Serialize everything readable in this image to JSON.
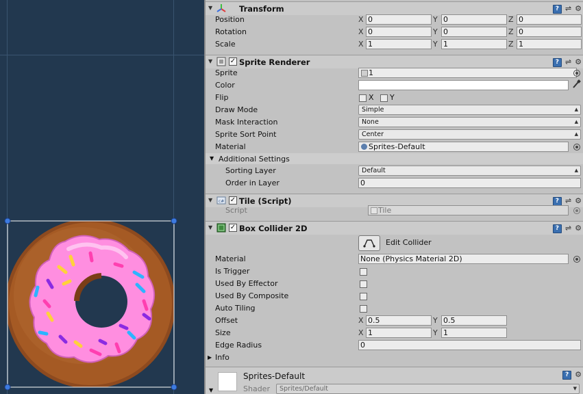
{
  "colors": {
    "scene_bg": "#22384f",
    "inspector_bg": "#c2c2c2",
    "selection_outline": "#ffffff",
    "handle": "#3d7be0",
    "icing": "#ff8ee0",
    "dough": "#9a5120"
  },
  "transform": {
    "title": "Transform",
    "position": {
      "label": "Position",
      "x": "0",
      "y": "0",
      "z": "0"
    },
    "rotation": {
      "label": "Rotation",
      "x": "0",
      "y": "0",
      "z": "0"
    },
    "scale": {
      "label": "Scale",
      "x": "1",
      "y": "1",
      "z": "1"
    },
    "x_label": "X",
    "y_label": "Y",
    "z_label": "Z"
  },
  "sprite_renderer": {
    "title": "Sprite Renderer",
    "sprite": {
      "label": "Sprite",
      "value": "1"
    },
    "color": {
      "label": "Color"
    },
    "flip": {
      "label": "Flip",
      "x": "X",
      "y": "Y"
    },
    "draw_mode": {
      "label": "Draw Mode",
      "value": "Simple"
    },
    "mask_interaction": {
      "label": "Mask Interaction",
      "value": "None"
    },
    "sprite_sort_point": {
      "label": "Sprite Sort Point",
      "value": "Center"
    },
    "material": {
      "label": "Material",
      "value": "Sprites-Default"
    },
    "additional_settings": "Additional Settings",
    "sorting_layer": {
      "label": "Sorting Layer",
      "value": "Default"
    },
    "order_in_layer": {
      "label": "Order in Layer",
      "value": "0"
    }
  },
  "tile_script": {
    "title": "Tile (Script)",
    "script": {
      "label": "Script",
      "value": "Tile"
    }
  },
  "box_collider": {
    "title": "Box Collider 2D",
    "edit_collider": "Edit Collider",
    "material": {
      "label": "Material",
      "value": "None (Physics Material 2D)"
    },
    "is_trigger": "Is Trigger",
    "used_by_effector": "Used By Effector",
    "used_by_composite": "Used By Composite",
    "auto_tiling": "Auto Tiling",
    "offset": {
      "label": "Offset",
      "x": "0.5",
      "y": "0.5"
    },
    "size": {
      "label": "Size",
      "x": "1",
      "y": "1"
    },
    "edge_radius": {
      "label": "Edge Radius",
      "value": "0"
    },
    "info": "Info",
    "x_label": "X",
    "y_label": "Y"
  },
  "material_preview": {
    "name": "Sprites-Default",
    "shader_label": "Shader",
    "shader_value": "Sprites/Default"
  },
  "icons": {
    "book": "?",
    "preset": "⇌",
    "gear": "⚙"
  }
}
